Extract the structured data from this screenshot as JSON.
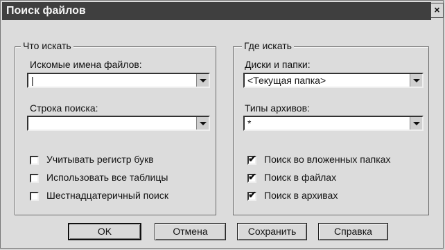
{
  "window": {
    "title": "Поиск файлов",
    "close_symbol": "×"
  },
  "what": {
    "legend": "Что искать",
    "names_label": "Искомые имена файлов:",
    "names_value": "|",
    "search_label": "Строка поиска:",
    "search_value": "",
    "options": [
      {
        "label": "Учитывать регистр букв",
        "checked": false
      },
      {
        "label": "Использовать все таблицы",
        "checked": false
      },
      {
        "label": "Шестнадцатеричный поиск",
        "checked": false
      }
    ]
  },
  "where": {
    "legend": "Где искать",
    "drives_label": "Диски и папки:",
    "drives_value": "<Текущая папка>",
    "archives_label": "Типы архивов:",
    "archives_value": "*",
    "options": [
      {
        "label": "Поиск во вложенных папках",
        "checked": true
      },
      {
        "label": "Поиск в файлах",
        "checked": true
      },
      {
        "label": "Поиск в архивах",
        "checked": true
      }
    ]
  },
  "buttons": {
    "ok": "OK",
    "cancel": "Отмена",
    "save": "Сохранить",
    "help": "Справка"
  },
  "check_symbol": "✔"
}
